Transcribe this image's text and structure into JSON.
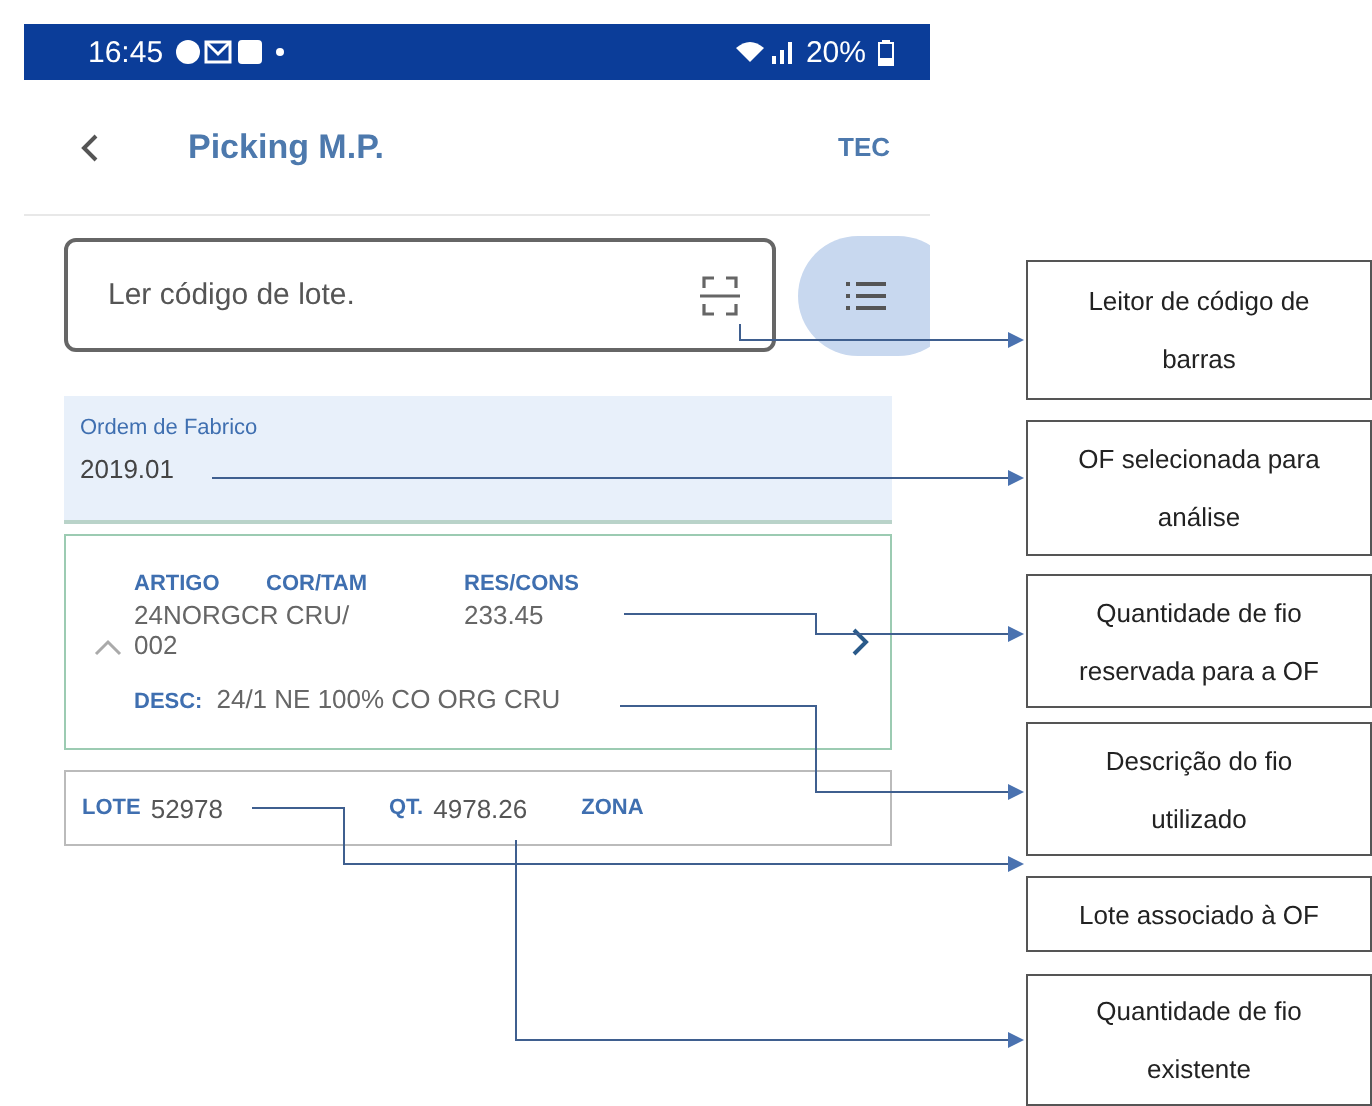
{
  "status_bar": {
    "time": "16:45",
    "battery": "20%"
  },
  "header": {
    "title": "Picking M.P.",
    "user": "TEC"
  },
  "search": {
    "placeholder": "Ler código de lote."
  },
  "order": {
    "label": "Ordem de Fabrico",
    "value": "2019.01"
  },
  "article": {
    "expanded": true,
    "columns": [
      "ARTIGO",
      "COR/TAM",
      "RES/CONS"
    ],
    "item": "24NORGCR CRU/ 002",
    "reserved": "233.45",
    "desc_label": "DESC:",
    "desc": "24/1 NE 100% CO ORG CRU"
  },
  "lot": {
    "lote_label": "LOTE",
    "lote": "52978",
    "qt_label": "QT.",
    "qt": "4978.26",
    "zona_label": "ZONA"
  },
  "annotations": [
    "Leitor de código de barras",
    "OF selecionada para análise",
    "Quantidade de fio reservada para a OF",
    "Descrição do fio utilizado",
    "Lote associado à OF",
    "Quantidade de fio existente"
  ]
}
